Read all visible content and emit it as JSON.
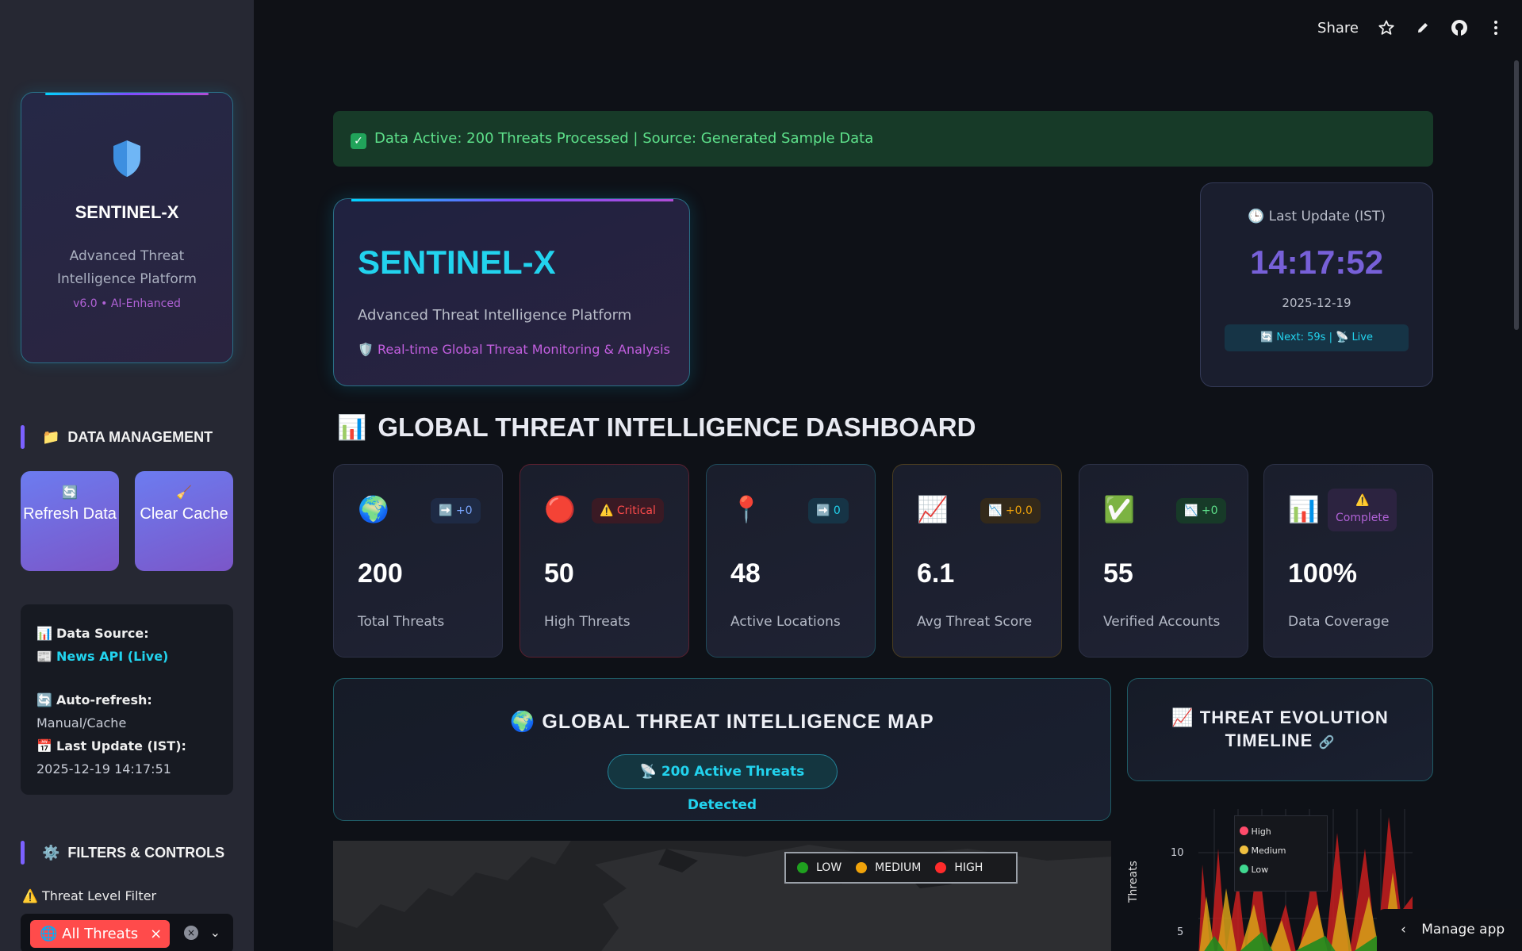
{
  "topbar": {
    "share_label": "Share"
  },
  "sidebar": {
    "brand": {
      "title": "SENTINEL-X",
      "subtitle": "Advanced Threat Intelligence Platform",
      "version": "v6.0 • AI-Enhanced"
    },
    "data_management": {
      "heading": "DATA MANAGEMENT",
      "refresh_label": "Refresh Data",
      "clear_label": "Clear Cache"
    },
    "info": {
      "source_label": "Data Source:",
      "source_value": "News API (Live)",
      "autorefresh_label": "Auto-refresh:",
      "autorefresh_value": "Manual/Cache",
      "last_update_label": "Last Update (IST):",
      "last_update_value": "2025-12-19 14:17:51"
    },
    "filters": {
      "heading": "FILTERS & CONTROLS",
      "threat_level_label": "Threat Level Filter",
      "selected_chip": "All Threats"
    }
  },
  "status_bar": {
    "text": "Data Active: 200 Threats Processed | Source: Generated Sample Data"
  },
  "hero": {
    "title": "SENTINEL-X",
    "subtitle": "Advanced Threat Intelligence Platform",
    "tagline": "Real-time Global Threat Monitoring & Analysis"
  },
  "clock": {
    "label": "Last Update (IST)",
    "time": "14:17:52",
    "date": "2025-12-19",
    "next": "Next: 59s |",
    "live": "Live"
  },
  "dashboard": {
    "title": "GLOBAL THREAT INTELLIGENCE DASHBOARD",
    "metrics": [
      {
        "value": "200",
        "label": "Total Threats",
        "badge": "+0",
        "icon": "globe-icon"
      },
      {
        "value": "50",
        "label": "High Threats",
        "badge": "Critical",
        "icon": "red-circle-icon"
      },
      {
        "value": "48",
        "label": "Active Locations",
        "badge": "0",
        "icon": "pin-icon"
      },
      {
        "value": "6.1",
        "label": "Avg Threat Score",
        "badge": "+0.0",
        "icon": "chart-up-icon"
      },
      {
        "value": "55",
        "label": "Verified Accounts",
        "badge": "+0",
        "icon": "check-icon"
      },
      {
        "value": "100%",
        "label": "Data Coverage",
        "badge": "Complete",
        "icon": "bar-chart-icon"
      }
    ]
  },
  "map_section": {
    "title": "GLOBAL THREAT INTELLIGENCE MAP",
    "pill": "200 Active Threats Detected",
    "legend": {
      "low": "LOW",
      "medium": "MEDIUM",
      "high": "HIGH"
    }
  },
  "timeline": {
    "title_line1": "THREAT EVOLUTION",
    "title_line2": "TIMELINE",
    "legend": {
      "high": "High",
      "medium": "Medium",
      "low": "Low"
    },
    "y_label": "Threats",
    "y_ticks": [
      "10",
      "5"
    ]
  },
  "colors": {
    "accent": "#22d3ee",
    "purple": "#7760d8",
    "high": "#ff2b2b",
    "medium": "#f0a30a",
    "low": "#1fa01f"
  },
  "manage": {
    "label": "Manage app"
  }
}
